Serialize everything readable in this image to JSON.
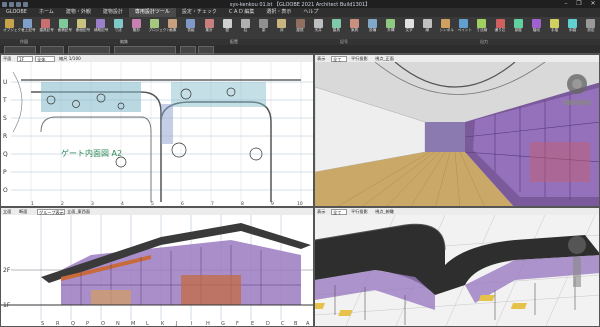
{
  "app": {
    "title": "sys-kenkou 01.bt 【GLOOBE 2021 Architect Build1301】",
    "window_buttons": [
      "–",
      "❐",
      "✕"
    ]
  },
  "menu": {
    "items": [
      "GLOOBE",
      "ホーム",
      "建物・外観",
      "建物設計",
      "専用設計ツール",
      "設定・チェック",
      "C A D 編集",
      "選択・表示",
      "ヘルプ"
    ],
    "active_index": 4
  },
  "ribbon": {
    "buttons": [
      {
        "label": "オブジェクト",
        "color": "#c9a34a"
      },
      {
        "label": "仕上記号",
        "color": "#7fa1c9"
      },
      {
        "label": "建具記号",
        "color": "#c96f6f"
      },
      {
        "label": "面積記号",
        "color": "#7fc99a"
      },
      {
        "label": "断面記号",
        "color": "#c9c27f"
      },
      {
        "label": "補助記号",
        "color": "#9a7fc9"
      },
      {
        "label": "寸法",
        "color": "#7fc9c9"
      },
      {
        "label": "雛形",
        "color": "#c97fb2"
      },
      {
        "label": "プロジェクト",
        "color": "#a4c97f"
      },
      {
        "label": "画像",
        "color": "#c9a07f"
      },
      {
        "label": "表組",
        "color": "#7f9ac9"
      },
      {
        "label": "集計",
        "color": "#c97f7f"
      },
      {
        "label": "壁",
        "color": "#d0d0d0"
      },
      {
        "label": "柱",
        "color": "#b0b0b0"
      },
      {
        "label": "梁",
        "color": "#909090"
      },
      {
        "label": "床",
        "color": "#c9b67f"
      },
      {
        "label": "屋根",
        "color": "#8f6f5f"
      },
      {
        "label": "天井",
        "color": "#bfbfbf"
      },
      {
        "label": "建具",
        "color": "#7fc9a8"
      },
      {
        "label": "家具",
        "color": "#c98f7f"
      },
      {
        "label": "設備",
        "color": "#7fa8c9"
      },
      {
        "label": "外構",
        "color": "#8fc97f"
      },
      {
        "label": "文字",
        "color": "#e0e0e0"
      },
      {
        "label": "線",
        "color": "#c0c0c0"
      },
      {
        "label": "シンボル",
        "color": "#d0a060"
      },
      {
        "label": "ペイント",
        "color": "#60a0d0"
      },
      {
        "label": "寸法線",
        "color": "#a0d060"
      },
      {
        "label": "通り芯",
        "color": "#d06060"
      },
      {
        "label": "部屋",
        "color": "#60d0a0"
      },
      {
        "label": "階段",
        "color": "#a060d0"
      },
      {
        "label": "手摺",
        "color": "#d0d060"
      },
      {
        "label": "斜路",
        "color": "#60d0d0"
      },
      {
        "label": "設定",
        "color": "#9a9a9a"
      }
    ],
    "group_labels": [
      "作図",
      "編集",
      "配置",
      "記号",
      "出力"
    ]
  },
  "panes": {
    "plan": {
      "toolbar": [
        "平面",
        "1F",
        "全体",
        "縮尺 1/100"
      ],
      "label": "平面"
    },
    "perspective_top": {
      "toolbar": [
        "表示",
        "全て",
        "平行投影",
        "視点_正面"
      ],
      "label": "パース"
    },
    "elevation": {
      "toolbar": [
        "立面",
        "断面",
        "グループ表示",
        "立面_東西面"
      ],
      "label": "立面"
    },
    "perspective_bottom": {
      "toolbar": [
        "表示",
        "全て",
        "平行投影",
        "視点_俯瞰"
      ],
      "label": "パース"
    }
  },
  "axis_labels": {
    "plan_rows": [
      "U",
      "T",
      "S",
      "R",
      "Q",
      "P",
      "O"
    ],
    "elevation_floors": [
      "2F",
      "1F"
    ],
    "elevation_grid": [
      "A",
      "B",
      "C",
      "D",
      "E",
      "F",
      "G",
      "H",
      "I",
      "J",
      "K",
      "L",
      "M",
      "N",
      "O",
      "P",
      "Q",
      "R",
      "S"
    ]
  },
  "plan_annotation": "ゲート内面図 A2"
}
